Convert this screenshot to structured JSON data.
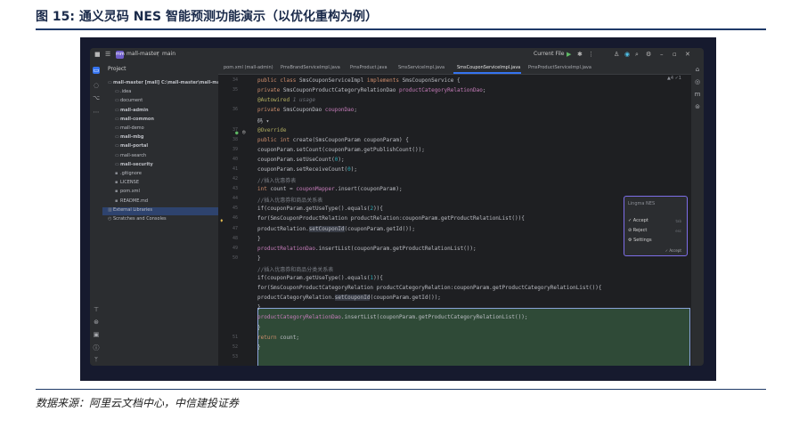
{
  "figure": {
    "title": "图 15: 通义灵码 NES 智能预测功能演示（以优化重构为例）",
    "source": "数据来源：阿里云文档中心，中信建投证券"
  },
  "titlebar": {
    "project_badge": "mm",
    "project_name": "mall-master",
    "branch": "main",
    "run_config": "Current File"
  },
  "project_panel": {
    "header": "Project",
    "items": [
      {
        "label": "mall-master [mall]  C:\\mall-master\\mall-master",
        "indent": 0,
        "icon": "folder",
        "bold": true
      },
      {
        "label": ".idea",
        "indent": 1,
        "icon": "folder",
        "bold": false
      },
      {
        "label": "document",
        "indent": 1,
        "icon": "folder",
        "bold": false
      },
      {
        "label": "mall-admin",
        "indent": 1,
        "icon": "folder",
        "bold": true
      },
      {
        "label": "mall-common",
        "indent": 1,
        "icon": "folder",
        "bold": true
      },
      {
        "label": "mall-demo",
        "indent": 1,
        "icon": "folder",
        "bold": false
      },
      {
        "label": "mall-mbg",
        "indent": 1,
        "icon": "folder",
        "bold": true
      },
      {
        "label": "mall-portal",
        "indent": 1,
        "icon": "folder",
        "bold": true
      },
      {
        "label": "mall-search",
        "indent": 1,
        "icon": "folder",
        "bold": false
      },
      {
        "label": "mall-security",
        "indent": 1,
        "icon": "folder",
        "bold": true
      },
      {
        "label": ".gitignore",
        "indent": 1,
        "icon": "file",
        "bold": false
      },
      {
        "label": "LICENSE",
        "indent": 1,
        "icon": "file",
        "bold": false
      },
      {
        "label": "pom.xml",
        "indent": 1,
        "icon": "file",
        "bold": false
      },
      {
        "label": "README.md",
        "indent": 1,
        "icon": "file",
        "bold": false
      },
      {
        "label": "External Libraries",
        "indent": 0,
        "icon": "library",
        "bold": false
      },
      {
        "label": "Scratches and Consoles",
        "indent": 0,
        "icon": "scratch",
        "bold": false
      }
    ]
  },
  "tabs": [
    {
      "label": "pom.xml (mall-admin)",
      "active": false
    },
    {
      "label": "PmsBrandServiceImpl.java",
      "active": false
    },
    {
      "label": "PmsProduct.java",
      "active": false
    },
    {
      "label": "SmsServiceImpl.java",
      "active": false
    },
    {
      "label": "SmsCouponServiceImpl.java",
      "active": true
    },
    {
      "label": "PmsProductServiceImpl.java",
      "active": false
    }
  ],
  "editor_hint": "▲4  ✓1",
  "code": {
    "lines": [
      {
        "n": "34",
        "t": "public class SmsCouponServiceImpl implements SmsCouponService {"
      },
      {
        "n": "35",
        "t": "    private SmsCouponProductCategoryRelationDao productCategoryRelationDao;"
      },
      {
        "n": "",
        "t": "    @Autowired  1 usage"
      },
      {
        "n": "36",
        "t": "    private SmsCouponDao couponDao;"
      },
      {
        "n": "",
        "t": "    码 ▾"
      },
      {
        "n": "37",
        "t": "    @Override"
      },
      {
        "n": "38",
        "t": "    public int create(SmsCouponParam couponParam) {"
      },
      {
        "n": "39",
        "t": "        couponParam.setCount(couponParam.getPublishCount());"
      },
      {
        "n": "40",
        "t": "        couponParam.setUseCount(0);"
      },
      {
        "n": "41",
        "t": "        couponParam.setReceiveCount(0);"
      },
      {
        "n": "42",
        "t": "        //插入优惠券表"
      },
      {
        "n": "43",
        "t": "        int count = couponMapper.insert(couponParam);"
      },
      {
        "n": "44",
        "t": "        //插入优惠券和商品关系表"
      },
      {
        "n": "45",
        "t": "        if(couponParam.getUseType().equals(2)){"
      },
      {
        "n": "46",
        "t": "            for(SmsCouponProductRelation productRelation:couponParam.getProductRelationList()){"
      },
      {
        "n": "47",
        "t": "                productRelation.setCouponId(couponParam.getId());"
      },
      {
        "n": "48",
        "t": "            }"
      },
      {
        "n": "49",
        "t": "            productRelationDao.insertList(couponParam.getProductRelationList());"
      },
      {
        "n": "50",
        "t": "        }"
      },
      {
        "n": "",
        "t": "        //插入优惠券和商品分类关系表"
      },
      {
        "n": "",
        "t": "        if(couponParam.getUseType().equals(1)){"
      },
      {
        "n": "",
        "t": "            for(SmsCouponProductCategoryRelation productCategoryRelation:couponParam.getProductCategoryRelationList()){"
      },
      {
        "n": "",
        "t": "                productCategoryRelation.setCouponId(couponParam.getId());"
      },
      {
        "n": "",
        "t": "            }"
      },
      {
        "n": "",
        "t": "            productCategoryRelationDao.insertList(couponParam.getProductCategoryRelationList());"
      },
      {
        "n": "",
        "t": "        }"
      },
      {
        "n": "51",
        "t": "        return count;"
      },
      {
        "n": "52",
        "t": "    }"
      },
      {
        "n": "53",
        "t": ""
      },
      {
        "n": "",
        "t": "    码 ▾"
      }
    ]
  },
  "nes_popup": {
    "title": "Lingma NES",
    "items": [
      {
        "label": "Accept",
        "key": "tab",
        "icon": "check-icon"
      },
      {
        "label": "Reject",
        "key": "esc",
        "icon": "close-icon"
      },
      {
        "label": "Settings",
        "key": "",
        "icon": "gear-icon"
      }
    ],
    "footer": "✓ Accept"
  }
}
